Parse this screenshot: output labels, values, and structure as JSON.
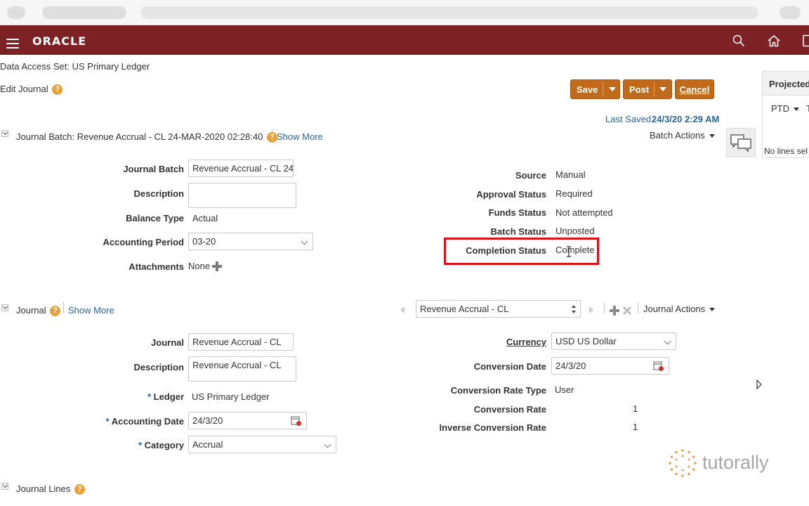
{
  "app": {
    "logo": "ORACLE"
  },
  "header": {
    "data_access_set": "Data Access Set: US Primary Ledger",
    "page_title": "Edit Journal",
    "save": "Save",
    "post": "Post",
    "cancel": "Cancel",
    "last_saved_label": "Last Saved",
    "last_saved_value": "24/3/20 2:29 AM",
    "batch_actions": "Batch Actions"
  },
  "batch": {
    "title": "Journal Batch: Revenue Accrual - CL 24-MAR-2020 02:28:40",
    "show_more": "Show More",
    "journal_batch_label": "Journal Batch",
    "journal_batch_value": "Revenue Accrual - CL 24",
    "description_label": "Description",
    "description_value": "",
    "balance_type_label": "Balance Type",
    "balance_type_value": "Actual",
    "accounting_period_label": "Accounting Period",
    "accounting_period_value": "03-20",
    "attachments_label": "Attachments",
    "attachments_value": "None",
    "source_label": "Source",
    "source_value": "Manual",
    "approval_status_label": "Approval Status",
    "approval_status_value": "Required",
    "funds_status_label": "Funds Status",
    "funds_status_value": "Not attempted",
    "batch_status_label": "Batch Status",
    "batch_status_value": "Unposted",
    "completion_status_label": "Completion Status",
    "completion_status_value": "Complete"
  },
  "journal": {
    "title": "Journal",
    "show_more": "Show More",
    "selector_value": "Revenue Accrual - CL",
    "journal_actions": "Journal Actions",
    "journal_label": "Journal",
    "journal_value": "Revenue Accrual - CL",
    "description_label": "Description",
    "description_value": "Revenue Accrual - CL",
    "ledger_label": "Ledger",
    "ledger_value": "US Primary Ledger",
    "accounting_date_label": "Accounting Date",
    "accounting_date_value": "24/3/20",
    "category_label": "Category",
    "category_value": "Accrual",
    "currency_label": "Currency",
    "currency_value": "USD US Dollar",
    "conversion_date_label": "Conversion Date",
    "conversion_date_value": "24/3/20",
    "conversion_rate_type_label": "Conversion Rate Type",
    "conversion_rate_type_value": "User",
    "conversion_rate_label": "Conversion Rate",
    "conversion_rate_value": "1",
    "inverse_conversion_rate_label": "Inverse Conversion Rate",
    "inverse_conversion_rate_value": "1"
  },
  "lines": {
    "title": "Journal Lines"
  },
  "side_panel": {
    "title": "Projected",
    "ptd": "PTD",
    "t": "T",
    "no_lines": "No lines sel"
  },
  "watermark": {
    "text": "tutorally"
  },
  "colors": {
    "brand_bar": "#7d2125",
    "action_button": "#bf6a1d",
    "link": "#2a6496",
    "highlight": "#e0101b"
  }
}
